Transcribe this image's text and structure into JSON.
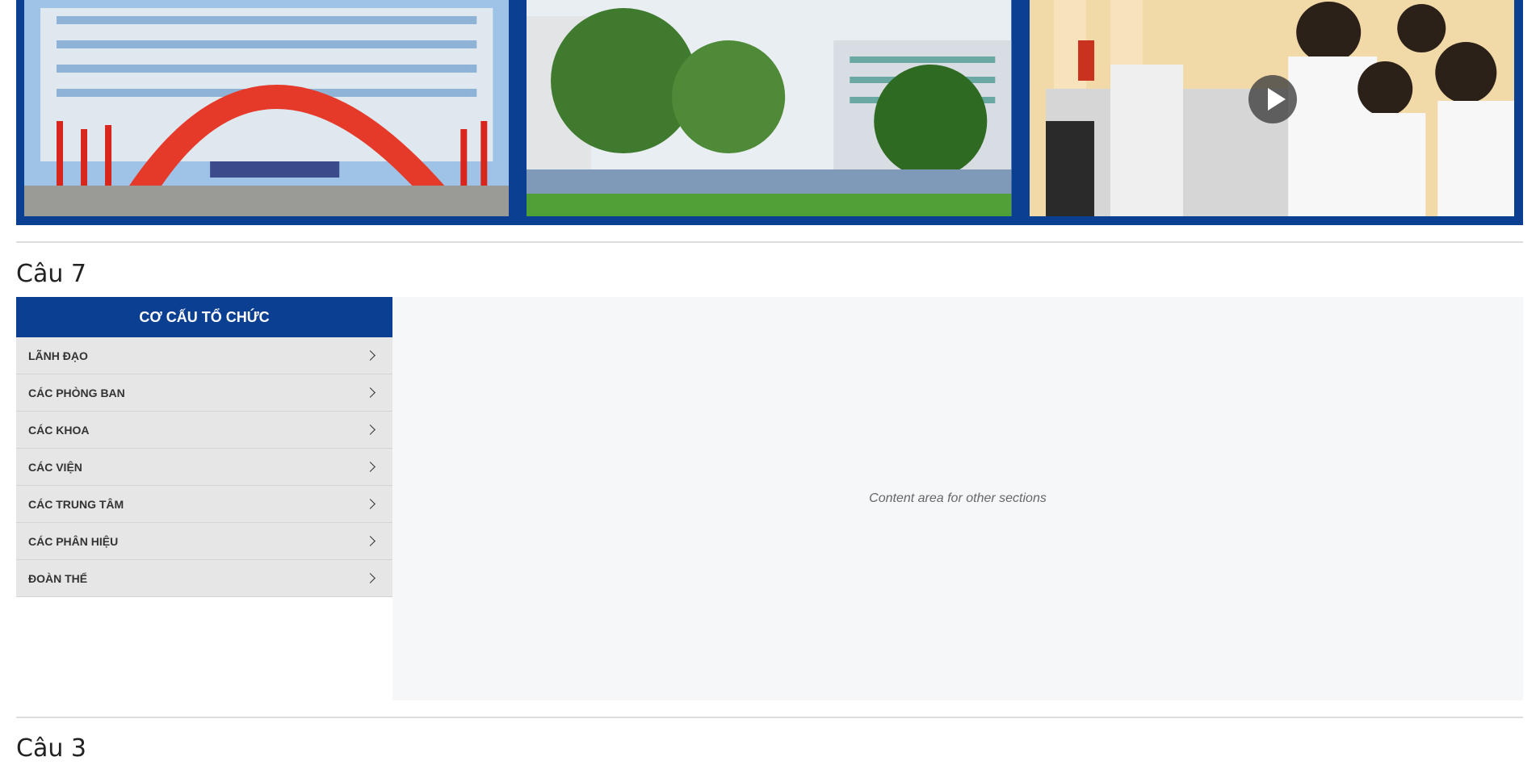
{
  "banner": {
    "photos": [
      {
        "name": "campus-gate-arch-photo"
      },
      {
        "name": "campus-trees-buildings-photo"
      },
      {
        "name": "laboratory-students-photo",
        "has_video": true
      }
    ]
  },
  "section7": {
    "title": "Câu 7",
    "org": {
      "header": "CƠ CẤU TỔ CHỨC",
      "items": [
        {
          "label": "LÃNH ĐẠO"
        },
        {
          "label": "CÁC PHÒNG BAN"
        },
        {
          "label": "CÁC KHOA"
        },
        {
          "label": "CÁC VIỆN"
        },
        {
          "label": "CÁC TRUNG TÂM"
        },
        {
          "label": "CÁC PHÂN HIỆU"
        },
        {
          "label": "ĐOÀN THỂ"
        }
      ]
    },
    "content_placeholder": "Content area for other sections"
  },
  "section3": {
    "title": "Câu 3"
  },
  "colors": {
    "brand_blue": "#0b3f91",
    "menu_bg": "#e6e6e6",
    "content_bg": "#f6f7f9"
  },
  "icons": [
    "play-icon",
    "chevron-right-icon"
  ]
}
